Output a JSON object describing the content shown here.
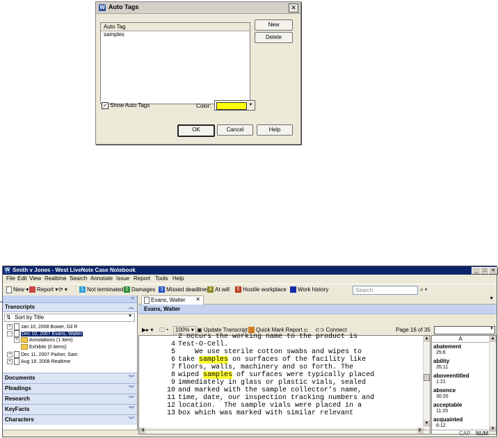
{
  "dialog": {
    "title": "Auto Tags",
    "list_header": "Auto Tag",
    "list_items": [
      "samples"
    ],
    "buttons": {
      "new": "New",
      "delete": "Delete",
      "ok": "OK",
      "cancel": "Cancel",
      "help": "Help"
    },
    "show_auto_tags": "Show Auto Tags",
    "show_auto_tags_checked": true,
    "color_label": "Color:",
    "color_value": "#ffff00"
  },
  "window": {
    "title": "Smith v Jones - West LiveNote Case Notebook",
    "menu": [
      "File",
      "Edit",
      "View",
      "Realtime",
      "Search",
      "Annotate",
      "Issue",
      "Report",
      "Tools",
      "Help"
    ],
    "toolbar": {
      "new": "New",
      "report": "Report",
      "issues": [
        {
          "num": "1",
          "label": "Not terminated",
          "color": "#2f9fd8"
        },
        {
          "num": "2",
          "label": "Damages",
          "color": "#2d8f3a"
        },
        {
          "num": "3",
          "label": "Missed deadlines",
          "color": "#2a54c8"
        },
        {
          "num": "4",
          "label": "At will",
          "color": "#8f8a1f"
        },
        {
          "num": "5",
          "label": "Hostile workplace",
          "color": "#b83a1a"
        },
        {
          "num": "",
          "label": "Work history",
          "color": "#1a2aa8"
        }
      ],
      "search_placeholder": "Search"
    },
    "left_panel": {
      "transcripts_header": "Transcripts",
      "sort_label": "Sort by Title",
      "tree": [
        {
          "label": "Jan 10, 2008   Bower, Gil R"
        },
        {
          "label": "Dec 10, 2007   Evans, Walter",
          "selected": true
        },
        {
          "label": "Annotations (1 item)"
        },
        {
          "label": "Exhibits (0 items)"
        },
        {
          "label": "Dec 11, 2007   Parker, Sam"
        },
        {
          "label": "Aug 19, 2008   Realtime"
        }
      ],
      "sections": [
        "Documents",
        "Pleadings",
        "Research",
        "KeyFacts",
        "Characters"
      ]
    },
    "doc": {
      "tab_label": "Evans, Walter",
      "header_name": "Evans, Walter",
      "zoom": "100%",
      "update_transcript": "Update Transcript",
      "quick_mark_report": "Quick Mark Report",
      "connect": "Connect",
      "page_info": "Page 16 of 35",
      "lines": [
        {
          "n": "",
          "pre": "2 occurs the working name to the product is",
          "hl": "",
          "post": ""
        },
        {
          "n": "4",
          "pre": "Test-O-Cell.",
          "hl": "",
          "post": ""
        },
        {
          "n": "5",
          "pre": "    We use sterile cotton swabs and wipes to",
          "hl": "",
          "post": ""
        },
        {
          "n": "6",
          "pre": "take ",
          "hl": "samples",
          "post": " on surfaces of the facility like"
        },
        {
          "n": "7",
          "pre": "floors, walls, machinery and so forth. The",
          "hl": "",
          "post": ""
        },
        {
          "n": "8",
          "pre": "wiped ",
          "hl": "samples",
          "post": " of surfaces were typically placed"
        },
        {
          "n": "9",
          "pre": "immediately in glass or plastic vials, sealed",
          "hl": "",
          "post": ""
        },
        {
          "n": "10",
          "pre": "and marked with the sample collector's name,",
          "hl": "",
          "post": ""
        },
        {
          "n": "11",
          "pre": "time, date, our inspection tracking numbers and",
          "hl": "",
          "post": ""
        },
        {
          "n": "12",
          "pre": "location.  The sample vials were placed in a",
          "hl": "",
          "post": ""
        },
        {
          "n": "13",
          "pre": "box which was marked with similar relevant",
          "hl": "",
          "post": ""
        }
      ],
      "word_index_header": "A",
      "word_index": [
        {
          "word": "abatement",
          "ref": "25:6"
        },
        {
          "word": "ability",
          "ref": "35:11"
        },
        {
          "word": "aboveentitled",
          "ref": "1:21"
        },
        {
          "word": "absence",
          "ref": "30:20"
        },
        {
          "word": "acceptable",
          "ref": "11:25"
        },
        {
          "word": "acquainted",
          "ref": "6:12"
        }
      ]
    },
    "status": {
      "cap": "CAP",
      "num": "NUM"
    }
  }
}
